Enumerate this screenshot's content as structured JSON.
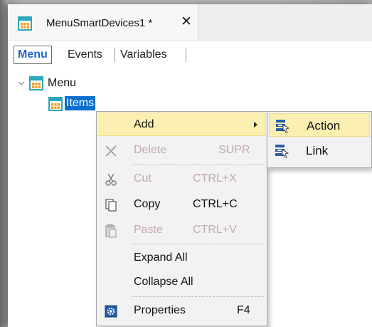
{
  "document_tab": {
    "title": "MenuSmartDevices1 *",
    "close_label": "✕",
    "icon": "menu-object-icon"
  },
  "subtabs": [
    {
      "label": "Menu",
      "active": true
    },
    {
      "label": "Events",
      "active": false
    },
    {
      "label": "Variables",
      "active": false
    }
  ],
  "tree": {
    "root": {
      "label": "Menu",
      "expanded": true,
      "icon": "menu-object-icon"
    },
    "child": {
      "label": "Items",
      "selected": true,
      "icon": "menu-object-icon"
    }
  },
  "context_menu": {
    "items": [
      {
        "label": "Add",
        "shortcut": "",
        "icon": "",
        "enabled": true,
        "has_submenu": true,
        "highlighted": true
      },
      {
        "label": "Delete",
        "shortcut": "SUPR",
        "icon": "delete-x-icon",
        "enabled": false
      },
      {
        "label": "Cut",
        "shortcut": "CTRL+X",
        "icon": "scissors-icon",
        "enabled": false
      },
      {
        "label": "Copy",
        "shortcut": "CTRL+C",
        "icon": "copy-icon",
        "enabled": true
      },
      {
        "label": "Paste",
        "shortcut": "CTRL+V",
        "icon": "paste-icon",
        "enabled": false
      },
      {
        "label": "Expand All",
        "shortcut": "",
        "icon": "",
        "enabled": true
      },
      {
        "label": "Collapse All",
        "shortcut": "",
        "icon": "",
        "enabled": true
      },
      {
        "label": "Properties",
        "shortcut": "F4",
        "icon": "properties-gear-icon",
        "enabled": true
      }
    ]
  },
  "submenu": {
    "items": [
      {
        "label": "Action",
        "icon": "action-item-icon",
        "highlighted": true
      },
      {
        "label": "Link",
        "icon": "link-item-icon",
        "highlighted": false
      }
    ]
  },
  "colors": {
    "selection": "#0a6ed1",
    "menu_highlight": "#fcefb2",
    "active_subtab_text": "#1f67c4",
    "disabled_text": "#c3a8b4",
    "icon_orange": "#f39c2a",
    "icon_teal": "#2aa7b8"
  }
}
